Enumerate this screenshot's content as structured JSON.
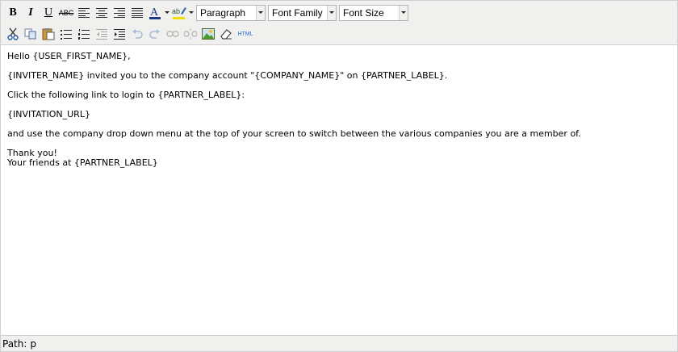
{
  "toolbar": {
    "bold_label": "B",
    "italic_label": "I",
    "underline_label": "U",
    "strikethrough_label": "ABC",
    "html_label": "HTML",
    "format_select": "Paragraph",
    "font_family_select": "Font Family",
    "font_size_select": "Font Size",
    "icons": [
      "bold-icon",
      "italic-icon",
      "underline-icon",
      "strikethrough-icon",
      "align-left-icon",
      "align-center-icon",
      "align-right-icon",
      "align-justify-icon",
      "text-color-icon",
      "highlight-color-icon",
      "cut-icon",
      "copy-icon",
      "paste-icon",
      "bullet-list-icon",
      "numbered-list-icon",
      "outdent-icon",
      "indent-icon",
      "undo-icon",
      "redo-icon",
      "link-icon",
      "unlink-icon",
      "image-icon",
      "eraser-icon",
      "html-source-icon"
    ],
    "colors": {
      "text_color": "#1a3a8a",
      "highlight_color": "#f0e000",
      "accent": "#2b6cd4"
    }
  },
  "content": {
    "greeting": "Hello {USER_FIRST_NAME},",
    "invite_line": "{INVITER_NAME} invited you to the company account \"{COMPANY_NAME}\" on {PARTNER_LABEL}.",
    "click_line": "Click the following link to login to {PARTNER_LABEL}:",
    "url_line": "{INVITATION_URL}",
    "switch_line": "and use the company drop down menu at the top of your screen to switch between the various companies you are a member of.",
    "thanks_line": "Thank you!",
    "signature_line": "Your friends at {PARTNER_LABEL}"
  },
  "status": {
    "path_label": "Path:",
    "path_value": "p"
  }
}
